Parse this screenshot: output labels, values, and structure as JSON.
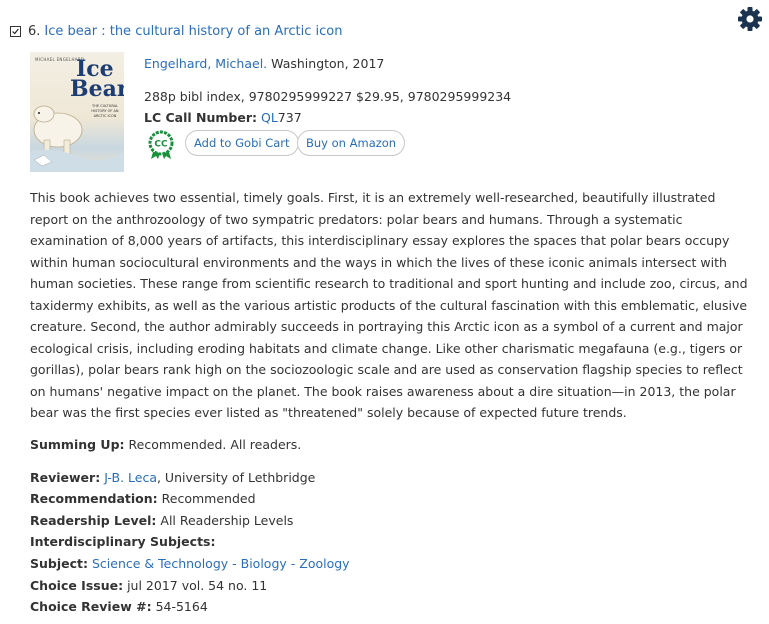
{
  "record": {
    "index": "6.",
    "title": "Ice bear : the cultural history of an Arctic icon",
    "author": "Engelhard, Michael.",
    "publication": "Washington, 2017",
    "details": "288p bibl index, 9780295999227 $29.95, 9780295999234",
    "lc_label": "LC Call Number:",
    "lc_class": "QL",
    "lc_number": "737"
  },
  "cover": {
    "author_text": "MICHAEL ENGELHARD",
    "title_line1": "Ice",
    "title_line2": "Bear",
    "subtitle": "THE CULTURAL HISTORY OF AN ARCTIC ICON"
  },
  "badge": {
    "text": "CC",
    "color": "#1a8f3c"
  },
  "buttons": {
    "gobi": "Add to Gobi Cart",
    "amazon": "Buy on Amazon"
  },
  "review_text": "This book achieves two essential, timely goals. First, it is an extremely well-researched, beautifully illustrated report on the anthrozoology of two sympatric predators: polar bears and humans. Through a systematic examination of 8,000 years of artifacts, this interdisciplinary essay explores the spaces that polar bears occupy within human sociocultural environments and the ways in which the lives of these iconic animals intersect with human societies. These range from scientific research to traditional and sport hunting and include zoo, circus, and taxidermy exhibits, as well as the various artistic products of the cultural fascination with this emblematic, elusive creature. Second, the author admirably succeeds in portraying this Arctic icon as a symbol of a current and major ecological crisis, including eroding habitats and climate change. Like other charismatic megafauna (e.g., tigers or gorillas), polar bears rank high on the sociozoologic scale and are used as conservation flagship species to reflect on humans' negative impact on the planet. The book raises awareness about a dire situation—in 2013, the polar bear was the first species ever listed as \"threatened\" solely because of expected future trends.",
  "summing": {
    "label": "Summing Up:",
    "value": "Recommended. All readers."
  },
  "reviewer": {
    "label": "Reviewer:",
    "name": "J-B. Leca",
    "affiliation": ", University of Lethbridge"
  },
  "recommendation": {
    "label": "Recommendation:",
    "value": "Recommended"
  },
  "readership": {
    "label": "Readership Level:",
    "value": "All Readership Levels"
  },
  "interdisciplinary": {
    "label": "Interdisciplinary Subjects:"
  },
  "subject": {
    "label": "Subject:",
    "items": [
      "Science & Technology",
      "Biology",
      "Zoology"
    ],
    "separator": " - "
  },
  "choice_issue": {
    "label": "Choice Issue:",
    "value": "jul 2017 vol. 54 no. 11"
  },
  "choice_review": {
    "label": "Choice Review #:",
    "value": "54-5164"
  },
  "icons": {
    "gear": "gear-icon",
    "checkbox": "checkbox-checked-icon"
  },
  "colors": {
    "link": "#2a6ebb",
    "gear": "#1c3350"
  }
}
